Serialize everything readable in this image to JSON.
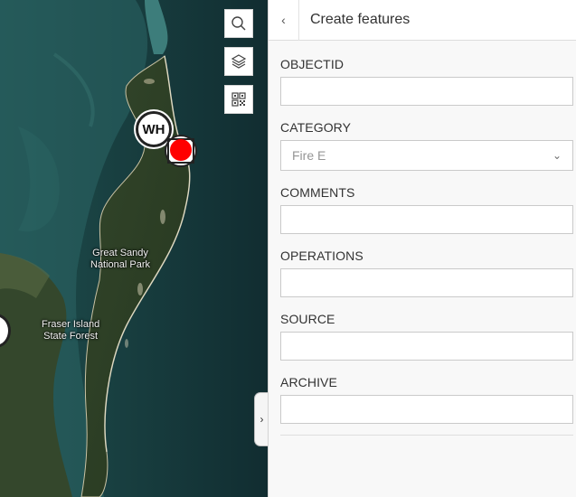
{
  "map": {
    "labels": {
      "great_sandy": "Great Sandy\nNational Park",
      "fraser_island": "Fraser Island\nState Forest"
    },
    "markers": {
      "wh_label": "WH"
    },
    "tools": {
      "search_icon": "search-icon",
      "layers_icon": "layers-icon",
      "qr_icon": "qr-code-icon"
    },
    "colors": {
      "fire_marker": "#ff0000"
    }
  },
  "panel": {
    "title": "Create features",
    "back_icon": "chevron-left-icon",
    "expand_icon": "chevron-right-icon",
    "fields": {
      "objectid": {
        "label": "OBJECTID",
        "value": ""
      },
      "category": {
        "label": "CATEGORY",
        "value": "Fire E"
      },
      "comments": {
        "label": "COMMENTS",
        "value": ""
      },
      "operations": {
        "label": "OPERATIONS",
        "value": ""
      },
      "source": {
        "label": "SOURCE",
        "value": ""
      },
      "archive": {
        "label": "ARCHIVE",
        "value": ""
      }
    }
  }
}
